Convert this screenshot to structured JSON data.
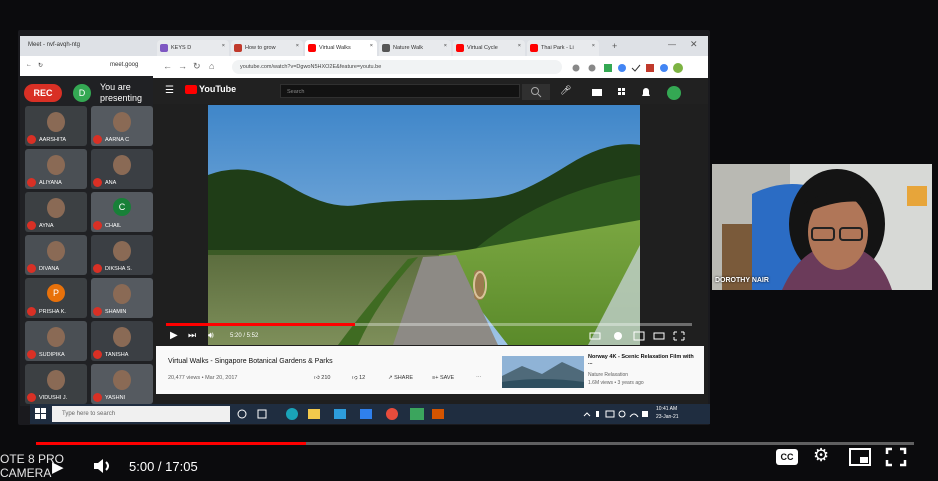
{
  "meet": {
    "tab_title": "Meet - nvf-avqh-ntg",
    "url": "meet.goog",
    "rec_label": "REC",
    "presenter_initial": "D",
    "presenting_text": "You are presenting",
    "participants": [
      {
        "name": "AARSHITA",
        "initial": ""
      },
      {
        "name": "AARNA C",
        "initial": ""
      },
      {
        "name": "ALIYANA",
        "initial": ""
      },
      {
        "name": "ANA",
        "initial": ""
      },
      {
        "name": "AYNA",
        "initial": ""
      },
      {
        "name": "CHAIL",
        "initial": "C"
      },
      {
        "name": "DIVANA",
        "initial": ""
      },
      {
        "name": "DIKSHA S.",
        "initial": ""
      },
      {
        "name": "PRISHA K.",
        "initial": "P"
      },
      {
        "name": "SHAMIN",
        "initial": ""
      },
      {
        "name": "SUDIPIKA",
        "initial": ""
      },
      {
        "name": "TANISHA",
        "initial": ""
      },
      {
        "name": "VIDUSHI J.",
        "initial": ""
      },
      {
        "name": "YASHNI",
        "initial": ""
      }
    ]
  },
  "browser": {
    "tabs": [
      {
        "label": "KEYS D",
        "color": "#7e57c2"
      },
      {
        "label": "How to grow",
        "color": "#c0392b"
      },
      {
        "label": "Virtual Walks",
        "color": "#ff0000"
      },
      {
        "label": "Nature Walk",
        "color": "#555555"
      },
      {
        "label": "Virtual Cycle",
        "color": "#ff0000"
      },
      {
        "label": "Thai Park - Li",
        "color": "#ff0000"
      }
    ],
    "url": "youtube.com/watch?v=DgwoN5HXO2E&feature=youtu.be"
  },
  "youtube": {
    "logo": "YouTube",
    "search_placeholder": "Search",
    "time": "5:20 / 5:52",
    "video_title": "Virtual Walks - Singapore Botanical Gardens & Parks",
    "video_meta": "20,477 views • Mar 20, 2017",
    "likes": "210",
    "dislikes": "12",
    "share": "SHARE",
    "save": "SAVE",
    "up_next_title": "Norway 4K - Scenic Relaxation Film with ...",
    "up_next_channel": "Nature Relaxation",
    "up_next_meta": "1.6M views • 3 years ago",
    "played_fraction": 0.36
  },
  "taskbar": {
    "search_placeholder": "Type here to search",
    "clock": "10:41 AM",
    "date": "23-Jan-21"
  },
  "webcam": {
    "name": "DOROTHY NAIR"
  },
  "outer_player": {
    "time": "5:00 / 17:05",
    "played_fraction": 0.307
  },
  "watermark": {
    "line1": "OTE 8 PRO",
    "line2": "CAMERA"
  },
  "colors": {
    "accent_red": "#ff0000",
    "meet_rec": "#d93025",
    "presenter_green": "#34a853"
  }
}
